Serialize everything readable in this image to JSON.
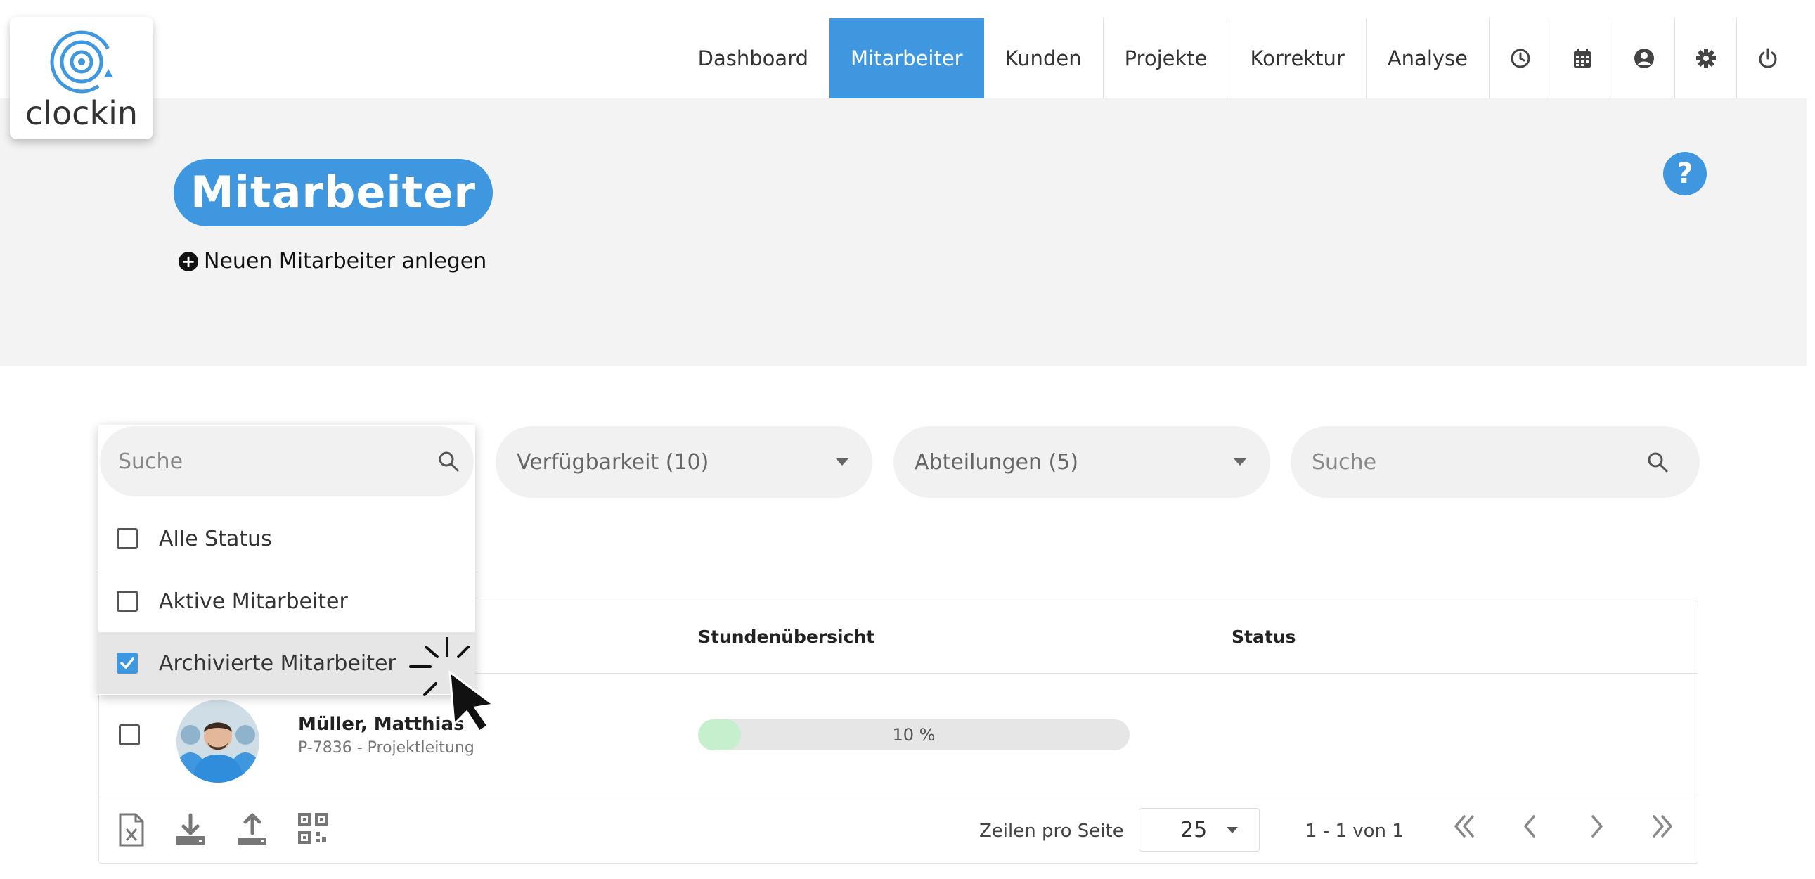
{
  "brand": {
    "logo_text": "clockin",
    "accent": "#3f97e0"
  },
  "nav": {
    "items": [
      "Dashboard",
      "Mitarbeiter",
      "Kunden",
      "Projekte",
      "Korrektur",
      "Analyse"
    ],
    "active": "Mitarbeiter",
    "icons": [
      "clock-icon",
      "calendar-icon",
      "user-icon",
      "gear-icon",
      "power-icon"
    ]
  },
  "page": {
    "title": "Mitarbeiter",
    "new_link": "Neuen Mitarbeiter anlegen",
    "help": "?"
  },
  "filters": {
    "availability": "Verfügbarkeit (10)",
    "departments": "Abteilungen (5)",
    "search_placeholder": "Suche"
  },
  "status_dropdown": {
    "search_placeholder": "Suche",
    "options": [
      {
        "label": "Alle Status",
        "checked": false
      },
      {
        "label": "Aktive Mitarbeiter",
        "checked": false
      },
      {
        "label": "Archivierte Mitarbeiter",
        "checked": true
      }
    ]
  },
  "table": {
    "headers": {
      "hours": "Stundenübersicht",
      "status": "Status"
    },
    "rows": [
      {
        "name": "Müller, Matthias",
        "sub": "P-7836 - Projektleitung",
        "progress": 10,
        "progress_label": "10 %"
      }
    ],
    "footer": {
      "rows_per_page_label": "Zeilen pro Seite",
      "rows_per_page": "25",
      "range": "1 - 1 von 1",
      "actions": [
        "excel-export-icon",
        "download-icon",
        "upload-icon",
        "qr-code-icon"
      ]
    }
  }
}
